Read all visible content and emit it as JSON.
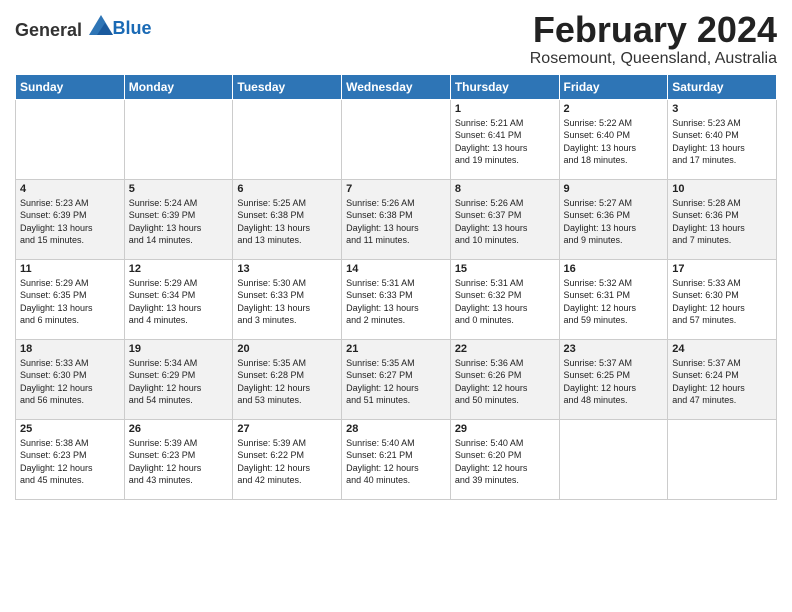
{
  "header": {
    "logo_general": "General",
    "logo_blue": "Blue",
    "title": "February 2024",
    "location": "Rosemount, Queensland, Australia"
  },
  "days_of_week": [
    "Sunday",
    "Monday",
    "Tuesday",
    "Wednesday",
    "Thursday",
    "Friday",
    "Saturday"
  ],
  "weeks": [
    [
      {
        "day": "",
        "detail": ""
      },
      {
        "day": "",
        "detail": ""
      },
      {
        "day": "",
        "detail": ""
      },
      {
        "day": "",
        "detail": ""
      },
      {
        "day": "1",
        "detail": "Sunrise: 5:21 AM\nSunset: 6:41 PM\nDaylight: 13 hours\nand 19 minutes."
      },
      {
        "day": "2",
        "detail": "Sunrise: 5:22 AM\nSunset: 6:40 PM\nDaylight: 13 hours\nand 18 minutes."
      },
      {
        "day": "3",
        "detail": "Sunrise: 5:23 AM\nSunset: 6:40 PM\nDaylight: 13 hours\nand 17 minutes."
      }
    ],
    [
      {
        "day": "4",
        "detail": "Sunrise: 5:23 AM\nSunset: 6:39 PM\nDaylight: 13 hours\nand 15 minutes."
      },
      {
        "day": "5",
        "detail": "Sunrise: 5:24 AM\nSunset: 6:39 PM\nDaylight: 13 hours\nand 14 minutes."
      },
      {
        "day": "6",
        "detail": "Sunrise: 5:25 AM\nSunset: 6:38 PM\nDaylight: 13 hours\nand 13 minutes."
      },
      {
        "day": "7",
        "detail": "Sunrise: 5:26 AM\nSunset: 6:38 PM\nDaylight: 13 hours\nand 11 minutes."
      },
      {
        "day": "8",
        "detail": "Sunrise: 5:26 AM\nSunset: 6:37 PM\nDaylight: 13 hours\nand 10 minutes."
      },
      {
        "day": "9",
        "detail": "Sunrise: 5:27 AM\nSunset: 6:36 PM\nDaylight: 13 hours\nand 9 minutes."
      },
      {
        "day": "10",
        "detail": "Sunrise: 5:28 AM\nSunset: 6:36 PM\nDaylight: 13 hours\nand 7 minutes."
      }
    ],
    [
      {
        "day": "11",
        "detail": "Sunrise: 5:29 AM\nSunset: 6:35 PM\nDaylight: 13 hours\nand 6 minutes."
      },
      {
        "day": "12",
        "detail": "Sunrise: 5:29 AM\nSunset: 6:34 PM\nDaylight: 13 hours\nand 4 minutes."
      },
      {
        "day": "13",
        "detail": "Sunrise: 5:30 AM\nSunset: 6:33 PM\nDaylight: 13 hours\nand 3 minutes."
      },
      {
        "day": "14",
        "detail": "Sunrise: 5:31 AM\nSunset: 6:33 PM\nDaylight: 13 hours\nand 2 minutes."
      },
      {
        "day": "15",
        "detail": "Sunrise: 5:31 AM\nSunset: 6:32 PM\nDaylight: 13 hours\nand 0 minutes."
      },
      {
        "day": "16",
        "detail": "Sunrise: 5:32 AM\nSunset: 6:31 PM\nDaylight: 12 hours\nand 59 minutes."
      },
      {
        "day": "17",
        "detail": "Sunrise: 5:33 AM\nSunset: 6:30 PM\nDaylight: 12 hours\nand 57 minutes."
      }
    ],
    [
      {
        "day": "18",
        "detail": "Sunrise: 5:33 AM\nSunset: 6:30 PM\nDaylight: 12 hours\nand 56 minutes."
      },
      {
        "day": "19",
        "detail": "Sunrise: 5:34 AM\nSunset: 6:29 PM\nDaylight: 12 hours\nand 54 minutes."
      },
      {
        "day": "20",
        "detail": "Sunrise: 5:35 AM\nSunset: 6:28 PM\nDaylight: 12 hours\nand 53 minutes."
      },
      {
        "day": "21",
        "detail": "Sunrise: 5:35 AM\nSunset: 6:27 PM\nDaylight: 12 hours\nand 51 minutes."
      },
      {
        "day": "22",
        "detail": "Sunrise: 5:36 AM\nSunset: 6:26 PM\nDaylight: 12 hours\nand 50 minutes."
      },
      {
        "day": "23",
        "detail": "Sunrise: 5:37 AM\nSunset: 6:25 PM\nDaylight: 12 hours\nand 48 minutes."
      },
      {
        "day": "24",
        "detail": "Sunrise: 5:37 AM\nSunset: 6:24 PM\nDaylight: 12 hours\nand 47 minutes."
      }
    ],
    [
      {
        "day": "25",
        "detail": "Sunrise: 5:38 AM\nSunset: 6:23 PM\nDaylight: 12 hours\nand 45 minutes."
      },
      {
        "day": "26",
        "detail": "Sunrise: 5:39 AM\nSunset: 6:23 PM\nDaylight: 12 hours\nand 43 minutes."
      },
      {
        "day": "27",
        "detail": "Sunrise: 5:39 AM\nSunset: 6:22 PM\nDaylight: 12 hours\nand 42 minutes."
      },
      {
        "day": "28",
        "detail": "Sunrise: 5:40 AM\nSunset: 6:21 PM\nDaylight: 12 hours\nand 40 minutes."
      },
      {
        "day": "29",
        "detail": "Sunrise: 5:40 AM\nSunset: 6:20 PM\nDaylight: 12 hours\nand 39 minutes."
      },
      {
        "day": "",
        "detail": ""
      },
      {
        "day": "",
        "detail": ""
      }
    ]
  ]
}
